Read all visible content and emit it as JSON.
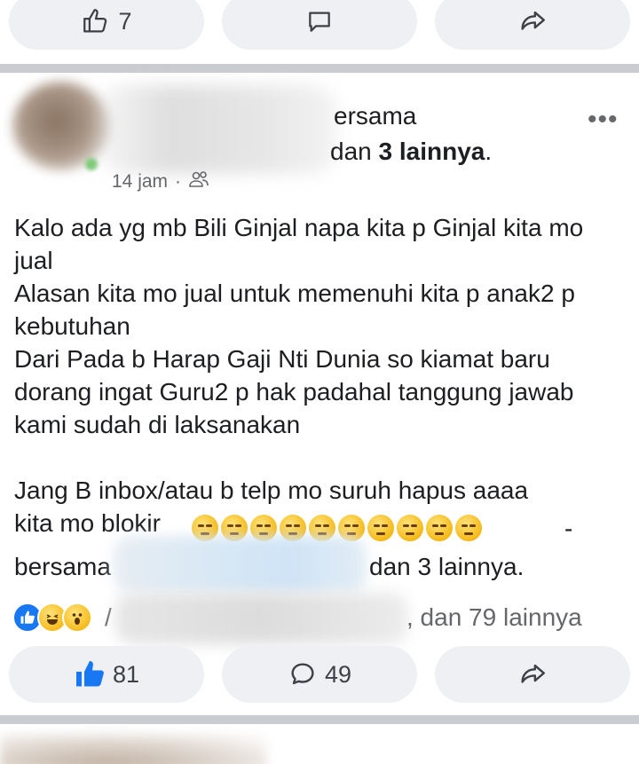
{
  "top_actions": {
    "like_count": "7",
    "like_icon": "thumbs-up-outline-icon",
    "comment_icon": "comment-icon",
    "share_icon": "share-icon"
  },
  "post": {
    "header_line1": "ersama",
    "header_line2_prefix": "dan ",
    "header_line2_count": "3 lainnya",
    "header_line2_suffix": ".",
    "more_icon": "more-dots-icon",
    "time": "14 jam",
    "audience_icon": "friends-icon",
    "paragraphs": [
      "Kalo ada yg mb Bili Ginjal napa kita p Ginjal kita mo jual",
      "Alasan kita mo jual untuk memenuhi kita p anak2 p kebutuhan",
      "Dari Pada b Harap Gaji Nti Dunia so kiamat baru dorang ingat Guru2 p hak padahal tanggung jawab kami sudah di laksanakan",
      "",
      "Jang B inbox/atau b telp mo suruh hapus aaaa",
      "kita mo blokir"
    ],
    "emoji_count": 10,
    "emoji_dash": "-",
    "tag_prefix": "bersama",
    "tag_suffix": "dan 3 lainnya."
  },
  "reactions": {
    "icons": [
      "like-reaction-icon",
      "haha-reaction-icon",
      "wow-reaction-icon"
    ],
    "summary_tail": ", dan 79 lainnya"
  },
  "bottom_actions": {
    "like_count": "81",
    "comment_count": "49",
    "like_icon": "thumbs-up-filled-icon",
    "comment_icon": "comment-icon",
    "share_icon": "share-icon"
  },
  "colors": {
    "accent": "#1877f2",
    "button_bg": "#eef0f3",
    "divider": "#c9ccd1",
    "secondary_text": "#65676b"
  }
}
